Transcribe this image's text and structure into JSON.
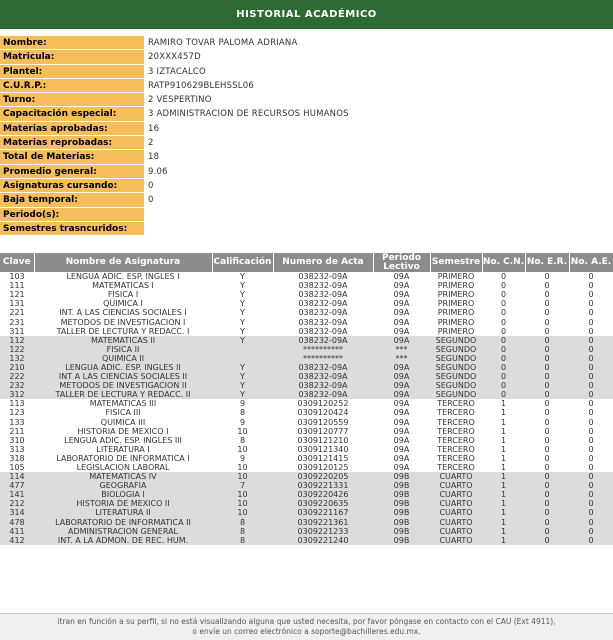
{
  "header": {
    "title": "HISTORIAL ACADÉMICO"
  },
  "student_info": [
    {
      "label": "Nombre:",
      "value": "RAMIRO TOVAR PALOMA ADRIANA"
    },
    {
      "label": "Matricula:",
      "value": "20XXX457D"
    },
    {
      "label": "Plantel:",
      "value": "3 IZTACALCO"
    },
    {
      "label": "C.U.R.P.:",
      "value": "RATP910629BLEHSSL06"
    },
    {
      "label": "Turno:",
      "value": "2 VESPERTINO"
    },
    {
      "label": "Capacitación especial:",
      "value": "3 ADMINISTRACION DE RECURSOS HUMANOS"
    },
    {
      "label": "Materias aprobadas:",
      "value": "16"
    },
    {
      "label": "Materias reprobadas:",
      "value": "2"
    },
    {
      "label": "Total de Materias:",
      "value": "18"
    },
    {
      "label": "Promedio general:",
      "value": "9.06"
    },
    {
      "label": "Asignaturas cursando:",
      "value": "0"
    },
    {
      "label": "Baja temporal:",
      "value": "0"
    },
    {
      "label": "Periodo(s):",
      "value": ""
    },
    {
      "label": "Semestres trasncuridos:",
      "value": ""
    }
  ],
  "table": {
    "headers": [
      "Clave",
      "Nombre de Asignatura",
      "Calificación",
      "Numero de Acta",
      "Periodo Lectivo",
      "Semestre",
      "No. C.N.",
      "No. E.R.",
      "No. A.E."
    ],
    "rows": [
      [
        "103",
        "LENGUA ADIC. ESP. INGLES I",
        "Y",
        "038232-09A",
        "09A",
        "PRIMERO",
        "0",
        "0",
        "0",
        "sem1"
      ],
      [
        "111",
        "MATEMATICAS I",
        "Y",
        "038232-09A",
        "09A",
        "PRIMERO",
        "0",
        "0",
        "0",
        "sem1"
      ],
      [
        "121",
        "FISICA I",
        "Y",
        "038232-09A",
        "09A",
        "PRIMERO",
        "0",
        "0",
        "0",
        "sem1"
      ],
      [
        "131",
        "QUIMICA I",
        "Y",
        "038232-09A",
        "09A",
        "PRIMERO",
        "0",
        "0",
        "0",
        "sem1"
      ],
      [
        "221",
        "INT. A LAS CIENCIAS SOCIALES I",
        "Y",
        "038232-09A",
        "09A",
        "PRIMERO",
        "0",
        "0",
        "0",
        "sem1"
      ],
      [
        "231",
        "METODOS DE INVESTIGACION I",
        "Y",
        "038232-09A",
        "09A",
        "PRIMERO",
        "0",
        "0",
        "0",
        "sem1"
      ],
      [
        "311",
        "TALLER DE LECTURA Y REDACC. I",
        "Y",
        "038232-09A",
        "09A",
        "PRIMERO",
        "0",
        "0",
        "0",
        "sem1"
      ],
      [
        "112",
        "MATEMATICAS II",
        "Y",
        "038232-09A",
        "09A",
        "SEGUNDO",
        "0",
        "0",
        "0",
        "sem2"
      ],
      [
        "122",
        "FISICA II",
        "",
        "**********",
        "***",
        "SEGUNDO",
        "0",
        "0",
        "0",
        "sem2"
      ],
      [
        "132",
        "QUIMICA II",
        "",
        "**********",
        "***",
        "SEGUNDO",
        "0",
        "0",
        "0",
        "sem2"
      ],
      [
        "210",
        "LENGUA ADIC. ESP. INGLES II",
        "Y",
        "038232-09A",
        "09A",
        "SEGUNDO",
        "0",
        "0",
        "0",
        "sem2"
      ],
      [
        "222",
        "INT A LAS CIENCIAS SOCIALES II",
        "Y",
        "038232-09A",
        "09A",
        "SEGUNDO",
        "0",
        "0",
        "0",
        "sem2"
      ],
      [
        "232",
        "METODOS DE INVESTIGACION II",
        "Y",
        "038232-09A",
        "09A",
        "SEGUNDO",
        "0",
        "0",
        "0",
        "sem2"
      ],
      [
        "312",
        "TALLER DE LECTURA Y REDACC. II",
        "Y",
        "038232-09A",
        "09A",
        "SEGUNDO",
        "0",
        "0",
        "0",
        "sem2"
      ],
      [
        "113",
        "MATEMATICAS III",
        "9",
        "0309120252",
        "09A",
        "TERCERO",
        "1",
        "0",
        "0",
        "sem3"
      ],
      [
        "123",
        "FISICA III",
        "8",
        "0309120424",
        "09A",
        "TERCERO",
        "1",
        "0",
        "0",
        "sem3"
      ],
      [
        "133",
        "QUIMICA III",
        "9",
        "0309120559",
        "09A",
        "TERCERO",
        "1",
        "0",
        "0",
        "sem3"
      ],
      [
        "211",
        "HISTORIA DE MEXICO I",
        "10",
        "0309120777",
        "09A",
        "TERCERO",
        "1",
        "0",
        "0",
        "sem3"
      ],
      [
        "310",
        "LENGUA ADIC. ESP. INGLES III",
        "8",
        "0309121210",
        "09A",
        "TERCERO",
        "1",
        "0",
        "0",
        "sem3"
      ],
      [
        "313",
        "LITERATURA I",
        "10",
        "0309121340",
        "09A",
        "TERCERO",
        "1",
        "0",
        "0",
        "sem3"
      ],
      [
        "318",
        "LABORATORIO DE INFORMATICA I",
        "9",
        "0309121415",
        "09A",
        "TERCERO",
        "1",
        "0",
        "0",
        "sem3"
      ],
      [
        "105",
        "LEGISLACION LABORAL",
        "10",
        "0309120125",
        "09A",
        "TERCERO",
        "1",
        "0",
        "0",
        "sem3"
      ],
      [
        "114",
        "MATEMATICAS IV",
        "10",
        "0309220205",
        "09B",
        "CUARTO",
        "1",
        "0",
        "0",
        "sem4"
      ],
      [
        "477",
        "GEOGRAFIA",
        "7",
        "0309221331",
        "09B",
        "CUARTO",
        "1",
        "0",
        "0",
        "sem4"
      ],
      [
        "141",
        "BIOLOGIA I",
        "10",
        "0309220426",
        "09B",
        "CUARTO",
        "1",
        "0",
        "0",
        "sem4"
      ],
      [
        "212",
        "HISTORIA DE MEXICO II",
        "10",
        "0309220635",
        "09B",
        "CUARTO",
        "1",
        "0",
        "0",
        "sem4"
      ],
      [
        "314",
        "LITERATURA II",
        "10",
        "0309221167",
        "09B",
        "CUARTO",
        "1",
        "0",
        "0",
        "sem4"
      ],
      [
        "478",
        "LABORATORIO DE INFORMATICA II",
        "8",
        "0309221361",
        "09B",
        "CUARTO",
        "1",
        "0",
        "0",
        "sem4"
      ],
      [
        "411",
        "ADMINISTRACION GENERAL",
        "8",
        "0309221233",
        "09B",
        "CUARTO",
        "1",
        "0",
        "0",
        "sem4"
      ],
      [
        "412",
        "INT. A LA ADMON. DE REC. HUM.",
        "8",
        "0309221240",
        "09B",
        "CUARTO",
        "1",
        "0",
        "0",
        "sem4"
      ]
    ]
  },
  "footer": {
    "line1": "itran en función a su perfil, si no está visualizando alguna que usted necesita, por favor póngase en contacto con el CAU (Ext 4911),",
    "line2": "o envíe un correo electrónico a soporte@bachilleres.edu.mx."
  }
}
